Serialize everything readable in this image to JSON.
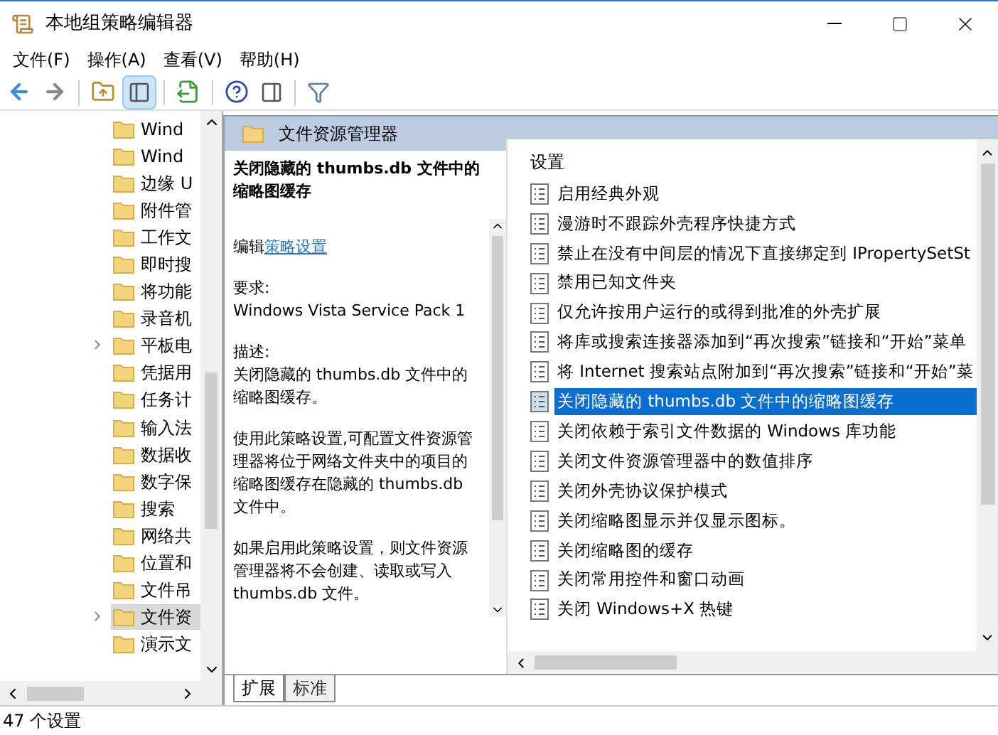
{
  "window": {
    "title": "本地组策略编辑器"
  },
  "menu": [
    "文件(F)",
    "操作(A)",
    "查看(V)",
    "帮助(H)"
  ],
  "tree": [
    {
      "label": "Wind",
      "expandable": false,
      "selected": false
    },
    {
      "label": "Wind",
      "expandable": false,
      "selected": false
    },
    {
      "label": "边缘 U",
      "expandable": false,
      "selected": false
    },
    {
      "label": "附件管",
      "expandable": false,
      "selected": false
    },
    {
      "label": "工作文",
      "expandable": false,
      "selected": false
    },
    {
      "label": "即时搜",
      "expandable": false,
      "selected": false
    },
    {
      "label": "将功能",
      "expandable": false,
      "selected": false
    },
    {
      "label": "录音机",
      "expandable": false,
      "selected": false
    },
    {
      "label": "平板电",
      "expandable": true,
      "selected": false
    },
    {
      "label": "凭据用",
      "expandable": false,
      "selected": false
    },
    {
      "label": "任务计",
      "expandable": false,
      "selected": false
    },
    {
      "label": "输入法",
      "expandable": false,
      "selected": false
    },
    {
      "label": "数据收",
      "expandable": false,
      "selected": false
    },
    {
      "label": "数字保",
      "expandable": false,
      "selected": false
    },
    {
      "label": "搜索",
      "expandable": false,
      "selected": false
    },
    {
      "label": "网络共",
      "expandable": false,
      "selected": false
    },
    {
      "label": "位置和",
      "expandable": false,
      "selected": false
    },
    {
      "label": "文件吊",
      "expandable": false,
      "selected": false
    },
    {
      "label": "文件资",
      "expandable": true,
      "selected": true
    },
    {
      "label": "演示文",
      "expandable": false,
      "selected": false
    }
  ],
  "pane_header": "文件资源管理器",
  "description": {
    "title": "关闭隐藏的 thumbs.db 文件中的缩略图缓存",
    "edit_prefix": "编辑",
    "edit_link": "策略设置",
    "requirement_label": "要求:",
    "requirement": "Windows Vista Service Pack 1",
    "description_label": "描述:",
    "paragraphs": [
      "关闭隐藏的 thumbs.db 文件中的缩略图缓存。",
      "使用此策略设置,可配置文件资源管理器将位于网络文件夹中的项目的缩略图缓存在隐藏的 thumbs.db 文件中。",
      "如果启用此策略设置，则文件资源管理器将不会创建、读取或写入 thumbs.db 文件。"
    ]
  },
  "settings": {
    "column": "设置",
    "rows": [
      {
        "label": "启用经典外观",
        "selected": false
      },
      {
        "label": "漫游时不跟踪外壳程序快捷方式",
        "selected": false
      },
      {
        "label": "禁止在没有中间层的情况下直接绑定到 IPropertySetSt",
        "selected": false
      },
      {
        "label": "禁用已知文件夹",
        "selected": false
      },
      {
        "label": "仅允许按用户运行的或得到批准的外壳扩展",
        "selected": false
      },
      {
        "label": "将库或搜索连接器添加到“再次搜索”链接和“开始”菜单",
        "selected": false
      },
      {
        "label": "将 Internet 搜索站点附加到“再次搜索”链接和“开始”菜",
        "selected": false
      },
      {
        "label": "关闭隐藏的 thumbs.db 文件中的缩略图缓存",
        "selected": true
      },
      {
        "label": "关闭依赖于索引文件数据的 Windows 库功能",
        "selected": false
      },
      {
        "label": "关闭文件资源管理器中的数值排序",
        "selected": false
      },
      {
        "label": "关闭外壳协议保护模式",
        "selected": false
      },
      {
        "label": "关闭缩略图显示并仅显示图标。",
        "selected": false
      },
      {
        "label": "关闭缩略图的缓存",
        "selected": false
      },
      {
        "label": "关闭常用控件和窗口动画",
        "selected": false
      },
      {
        "label": "关闭 Windows+X 热键",
        "selected": false
      }
    ]
  },
  "tabs": [
    {
      "label": "扩展",
      "selected": true
    },
    {
      "label": "标准",
      "selected": false
    }
  ],
  "status_bar": "47 个设置"
}
